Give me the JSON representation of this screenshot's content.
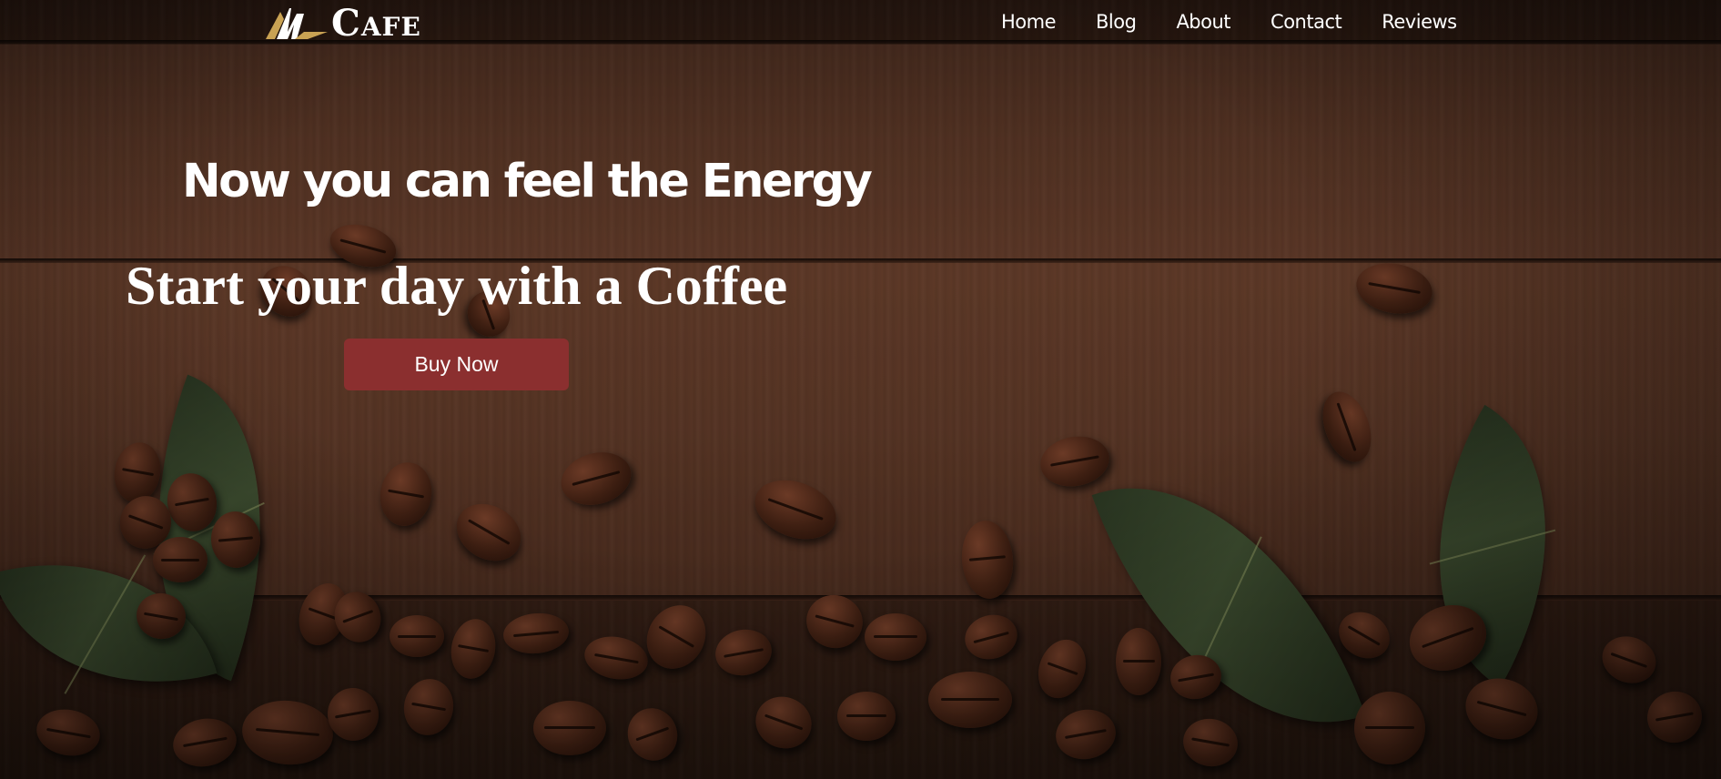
{
  "brand": {
    "name": "Cafe",
    "logo_icon": "cafe-logo-icon",
    "accent_color": "#c9a253"
  },
  "nav": {
    "items": [
      {
        "label": "Home"
      },
      {
        "label": "Blog"
      },
      {
        "label": "About"
      },
      {
        "label": "Contact"
      },
      {
        "label": "Reviews"
      }
    ]
  },
  "hero": {
    "subtitle": "Now you can feel the Energy",
    "title": "Start your day with a Coffee",
    "button_label": "Buy Now",
    "button_color": "#8b2f2f"
  },
  "background": {
    "theme": "coffee beans and leaves on dark wooden table",
    "wood_color": "#4a2c1f"
  }
}
